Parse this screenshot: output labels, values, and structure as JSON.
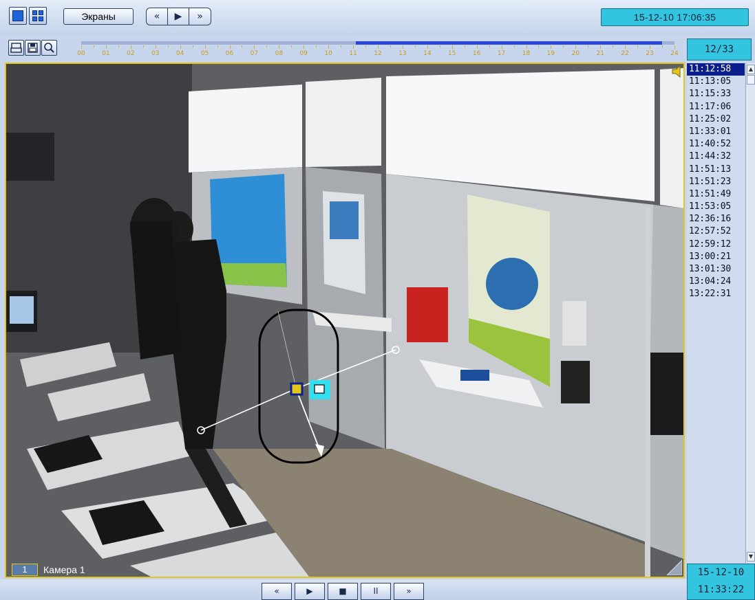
{
  "toolbar": {
    "screens_label": "Экраны",
    "nav_buttons": [
      "«",
      "▶",
      "»"
    ],
    "datetime": "15-12-10  17:06:35"
  },
  "timeline": {
    "hour_labels": [
      "00",
      "01",
      "02",
      "03",
      "04",
      "05",
      "06",
      "07",
      "08",
      "09",
      "10",
      "11",
      "12",
      "13",
      "14",
      "15",
      "16",
      "17",
      "18",
      "19",
      "20",
      "21",
      "22",
      "23",
      "24"
    ],
    "fill_start_hour": 11.1,
    "fill_end_hour": 23.5
  },
  "counter": "12/33",
  "camera": {
    "number": "1",
    "name": "Камера 1"
  },
  "events": {
    "selected_index": 0,
    "items": [
      "11:12:58",
      "11:13:05",
      "11:15:33",
      "11:17:06",
      "11:25:02",
      "11:33:01",
      "11:40:52",
      "11:44:32",
      "11:51:13",
      "11:51:23",
      "11:51:49",
      "11:53:05",
      "12:36:16",
      "12:57:52",
      "12:59:12",
      "13:00:21",
      "13:01:30",
      "13:04:24",
      "13:22:31"
    ]
  },
  "current": {
    "date": "15-12-10",
    "time": "11:33:22"
  },
  "playback_buttons": [
    "«",
    "▶",
    "■",
    "II",
    "»"
  ],
  "colors": {
    "accent_cyan": "#33c4e0",
    "frame_yellow": "#e4c51c",
    "selected": "#0a1f8c"
  }
}
